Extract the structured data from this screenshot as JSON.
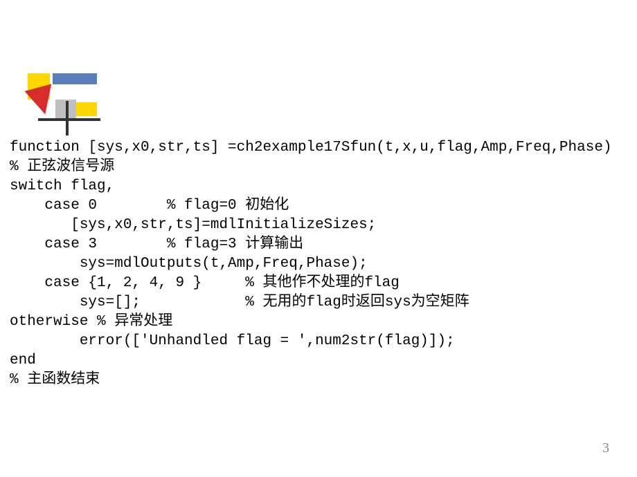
{
  "code": {
    "line1": "function [sys,x0,str,ts] =ch2example17Sfun(t,x,u,flag,Amp,Freq,Phase)",
    "line2": "% 正弦波信号源",
    "line3": "switch flag,",
    "line4": "    case 0        % flag=0 初始化",
    "line5": "       [sys,x0,str,ts]=mdlInitializeSizes;",
    "line6": "    case 3        % flag=3 计算输出",
    "line7": "        sys=mdlOutputs(t,Amp,Freq,Phase);",
    "line8": "    case {1, 2, 4, 9 }     % 其他作不处理的flag",
    "line9": "        sys=[];            % 无用的flag时返回sys为空矩阵",
    "line10": "otherwise % 异常处理",
    "line11": "        error(['Unhandled flag = ',num2str(flag)]);",
    "line12": "end",
    "line13": "% 主函数结束"
  },
  "page_number": "3"
}
